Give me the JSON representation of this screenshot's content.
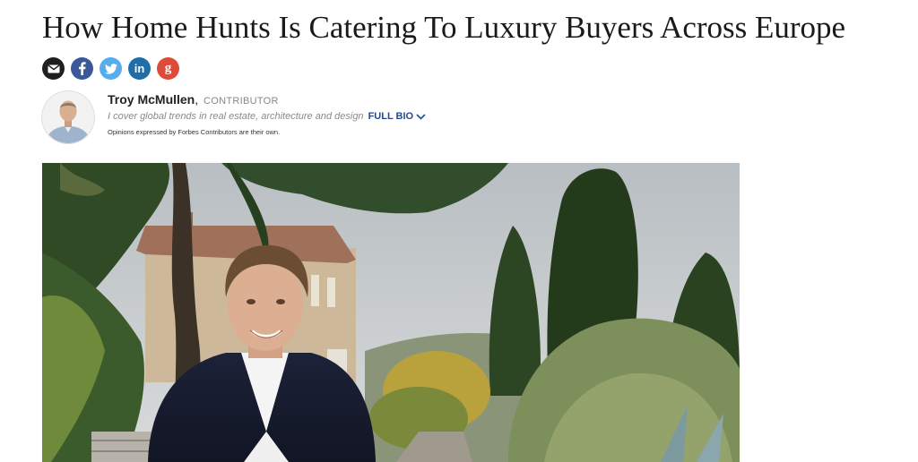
{
  "article": {
    "headline": "How Home Hunts Is Catering To Luxury Buyers Across Europe"
  },
  "share": {
    "buttons": [
      {
        "name": "email",
        "icon": "envelope-icon",
        "color": "#1f1f1f"
      },
      {
        "name": "facebook",
        "icon": "facebook-icon",
        "color": "#3b5998"
      },
      {
        "name": "twitter",
        "icon": "twitter-icon",
        "color": "#55acee"
      },
      {
        "name": "linkedin",
        "icon": "linkedin-icon",
        "color": "#1f6ea8"
      },
      {
        "name": "google-plus",
        "icon": "google-plus-icon",
        "color": "#dd4b39"
      }
    ],
    "linkedin_label": "in",
    "google_label": "g"
  },
  "author": {
    "name": "Troy McMullen",
    "separator": ",",
    "role": "CONTRIBUTOR",
    "tagline": "I cover global trends in real estate, architecture and design",
    "full_bio_label": "FULL BIO",
    "disclaimer": "Opinions expressed by Forbes Contributors are their own."
  },
  "colors": {
    "link_blue": "#234a8e",
    "headline": "#1a1a1a",
    "meta_gray": "#888888"
  }
}
